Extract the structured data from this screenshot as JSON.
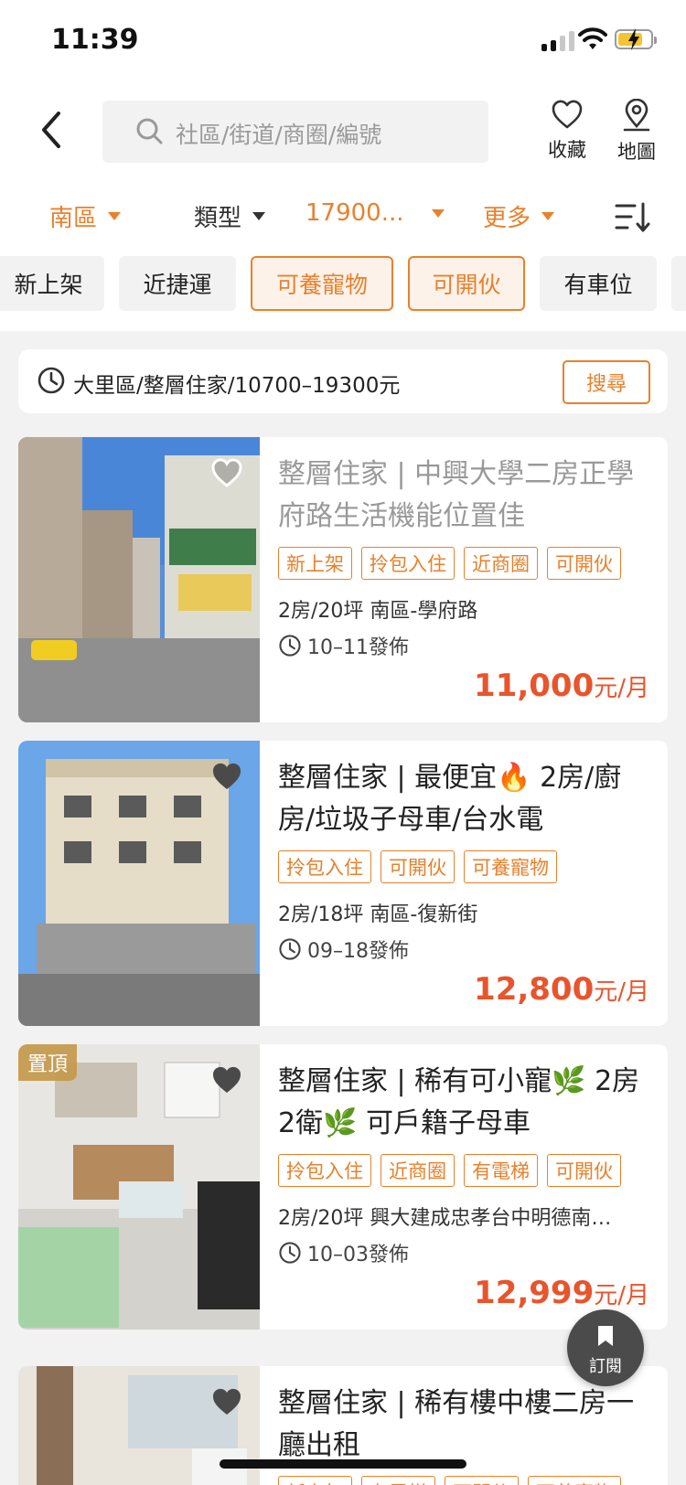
{
  "status_bar": {
    "time": "11:39"
  },
  "header": {
    "search_placeholder": "社區/街道/商圈/編號",
    "favorite_label": "收藏",
    "map_label": "地圖"
  },
  "filters": {
    "region": "南區",
    "type": "類型",
    "price": "17900...",
    "more": "更多"
  },
  "chips": [
    "新上架",
    "近捷運",
    "可養寵物",
    "可開伙",
    "有車位"
  ],
  "active_chips": [
    "可養寵物",
    "可開伙"
  ],
  "recent_search": {
    "text": "大里區/整層住家/10700–19300元",
    "button": "搜尋"
  },
  "listings": [
    {
      "title": "整層住家 | 中興大學二房正學府路生活機能位置佳",
      "tags": [
        "新上架",
        "拎包入住",
        "近商圈",
        "可開伙"
      ],
      "meta": "2房/20坪  南區-學府路",
      "date": "10–11發佈",
      "price": "11,000",
      "unit": "元/月"
    },
    {
      "title": "整層住家 | 最便宜🔥 2房/廚房/垃圾子母車/台水電",
      "tags": [
        "拎包入住",
        "可開伙",
        "可養寵物"
      ],
      "meta": "2房/18坪  南區-復新街",
      "date": "09–18發佈",
      "price": "12,800",
      "unit": "元/月"
    },
    {
      "badge": "置頂",
      "title": "整層住家 | 稀有可小寵🌿 2房2衛🌿 可戶籍子母車",
      "tags": [
        "拎包入住",
        "近商圈",
        "有電梯",
        "可開伙"
      ],
      "meta": "2房/20坪  興大建成忠孝台中明德南…",
      "date": "10–03發佈",
      "price": "12,999",
      "unit": "元/月"
    },
    {
      "title": "整層住家 | 稀有樓中樓二房一廳出租",
      "tags": [
        "新上架",
        "有電梯",
        "可開伙",
        "可養寵物"
      ]
    }
  ],
  "fab": {
    "label": "訂閱"
  },
  "colors": {
    "accent": "#e8812c",
    "price": "#e8542c"
  }
}
